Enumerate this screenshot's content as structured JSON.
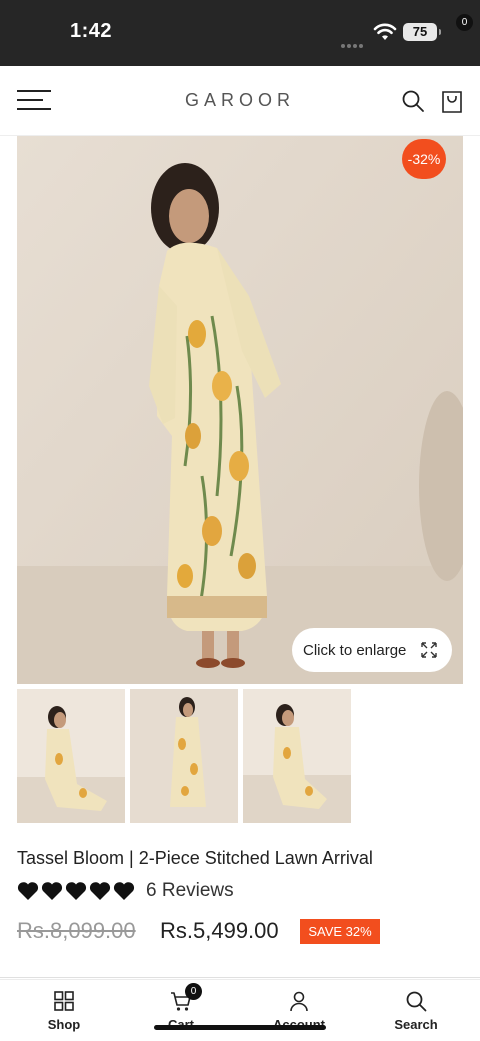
{
  "status_bar": {
    "time": "1:42",
    "battery": "75"
  },
  "header": {
    "brand": "GAROOR",
    "cart_count": "0"
  },
  "product": {
    "discount_badge": "-32%",
    "enlarge_label": "Click to enlarge",
    "title": "Tassel Bloom | 2-Piece Stitched Lawn Arrival",
    "rating": 5,
    "reviews": "6 Reviews",
    "old_price": "Rs.8,099.00",
    "new_price": "Rs.5,499.00",
    "save_label": "SAVE 32%"
  },
  "bottom_nav": {
    "items": [
      {
        "label": "Shop",
        "icon": "grid-icon"
      },
      {
        "label": "Cart",
        "icon": "cart-icon",
        "badge": "0"
      },
      {
        "label": "Account",
        "icon": "user-icon"
      },
      {
        "label": "Search",
        "icon": "search-icon"
      }
    ]
  },
  "colors": {
    "accent": "#f24e1e",
    "status_bar": "#262626",
    "text": "#222222",
    "muted": "#999999"
  }
}
